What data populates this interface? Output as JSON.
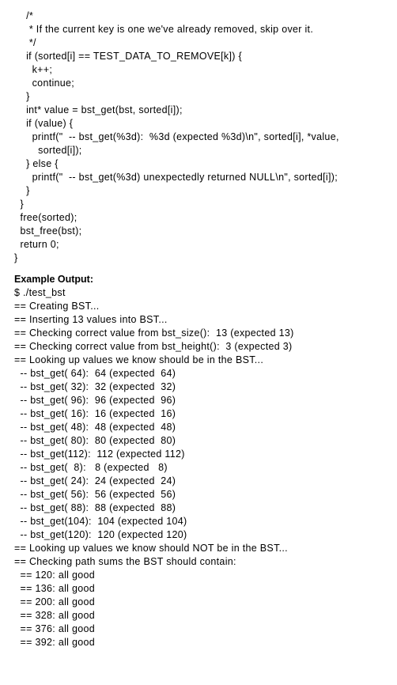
{
  "code": {
    "lines": [
      "    /*",
      "     * If the current key is one we've already removed, skip over it.",
      "     */",
      "    if (sorted[i] == TEST_DATA_TO_REMOVE[k]) {",
      "      k++;",
      "      continue;",
      "    }",
      "    int* value = bst_get(bst, sorted[i]);",
      "    if (value) {",
      "      printf(\"  -- bst_get(%3d):  %3d (expected %3d)\\n\", sorted[i], *value,",
      "        sorted[i]);",
      "    } else {",
      "      printf(\"  -- bst_get(%3d) unexpectedly returned NULL\\n\", sorted[i]);",
      "    }",
      "  }",
      "  free(sorted);",
      "  bst_free(bst);",
      "  return 0;",
      "}"
    ]
  },
  "heading": "Example Output:",
  "output": {
    "lines": [
      "$ ./test_bst",
      "== Creating BST...",
      "== Inserting 13 values into BST...",
      "== Checking correct value from bst_size():  13 (expected 13)",
      "== Checking correct value from bst_height():  3 (expected 3)",
      "== Looking up values we know should be in the BST...",
      "  -- bst_get( 64):  64 (expected  64)",
      "  -- bst_get( 32):  32 (expected  32)",
      "  -- bst_get( 96):  96 (expected  96)",
      "  -- bst_get( 16):  16 (expected  16)",
      "  -- bst_get( 48):  48 (expected  48)",
      "  -- bst_get( 80):  80 (expected  80)",
      "  -- bst_get(112):  112 (expected 112)",
      "  -- bst_get(  8):   8 (expected   8)",
      "  -- bst_get( 24):  24 (expected  24)",
      "  -- bst_get( 56):  56 (expected  56)",
      "  -- bst_get( 88):  88 (expected  88)",
      "  -- bst_get(104):  104 (expected 104)",
      "  -- bst_get(120):  120 (expected 120)",
      "== Looking up values we know should NOT be in the BST...",
      "== Checking path sums the BST should contain:",
      "  == 120: all good",
      "  == 136: all good",
      "  == 200: all good",
      "  == 328: all good",
      "  == 376: all good",
      "  == 392: all good"
    ]
  }
}
